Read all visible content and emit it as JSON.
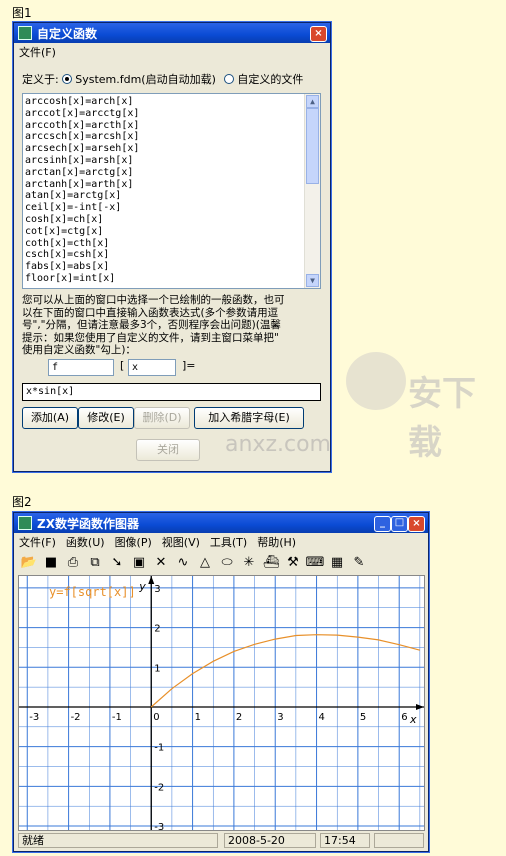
{
  "fig1": {
    "caption": "图1",
    "title": "自定义函数",
    "menu": [
      "文件(F)"
    ],
    "define_label": "定义于:",
    "radio_system": "System.fdm(启动自动加载)",
    "radio_custom": "自定义的文件",
    "functions": [
      "arccosh[x]=arch[x]",
      "arccot[x]=arcctg[x]",
      "arccoth[x]=arcth[x]",
      "arccsch[x]=arcsh[x]",
      "arcsech[x]=arseh[x]",
      "arcsinh[x]=arsh[x]",
      "arctan[x]=arctg[x]",
      "arctanh[x]=arth[x]",
      "atan[x]=arctg[x]",
      "ceil[x]=-int[-x]",
      "cosh[x]=ch[x]",
      "cot[x]=ctg[x]",
      "coth[x]=cth[x]",
      "csch[x]=csh[x]",
      "fabs[x]=abs[x]",
      "floor[x]=int[x]"
    ],
    "help_lines": [
      "您可以从上面的窗口中选择一个已绘制的一般函数，也可",
      "以在下面的窗口中直接输入函数表达式(多个参数请用逗",
      "号\",\"分隔，但请注意最多3个，否则程序会出问题)(温馨",
      "提示：如果您使用了自定义的文件，请到主窗口菜单把\"",
      "使用自定义函数\"勾上)："
    ],
    "func_name": "f",
    "param": "x",
    "bracket_open": "[",
    "bracket_close": "]=",
    "expression": "x*sin[x]",
    "btn_add": "添加(A)",
    "btn_modify": "修改(E)",
    "btn_delete": "删除(D)",
    "btn_add_greek": "加入希腊字母(E)",
    "btn_close": "关闭",
    "close_icon": "×"
  },
  "watermark": {
    "text": "安下载",
    "url": "anxz.com"
  },
  "fig2": {
    "caption": "图2",
    "title": "ZX数学函数作图器",
    "menu": [
      "文件(F)",
      "函数(U)",
      "图像(P)",
      "视图(V)",
      "工具(T)",
      "帮助(H)"
    ],
    "toolbar_icons": [
      "open-icon",
      "save-icon",
      "print-icon",
      "copy-icon",
      "arrow-icon",
      "frame-icon",
      "cross-icon",
      "curve-icon",
      "triangle-icon",
      "ellipse-icon",
      "asterisk-icon",
      "ship-icon",
      "hammer-icon",
      "keyboard-icon",
      "calculator-icon",
      "tool-icon"
    ],
    "status_text": "就绪",
    "status_date": "2008-5-20",
    "status_time": "17:54",
    "min_icon": "_",
    "max_icon": "□",
    "close_icon": "×"
  },
  "chart_data": {
    "type": "line",
    "series": [
      {
        "name": "y=f[sqrt[x]]",
        "function": "y=sqrt(x)*sin(sqrt(x))",
        "x": [
          0,
          0.5,
          1,
          1.5,
          2,
          2.5,
          3,
          3.5,
          4,
          4.5,
          5,
          5.5,
          6,
          6.5
        ],
        "y": [
          0,
          0.46,
          0.84,
          1.15,
          1.4,
          1.58,
          1.71,
          1.8,
          1.82,
          1.81,
          1.76,
          1.69,
          1.57,
          1.43
        ]
      }
    ],
    "xlabel": "x",
    "ylabel": "y",
    "xlim": [
      -3.2,
      6.6
    ],
    "ylim": [
      -3.1,
      3.3
    ],
    "xticks": [
      -3,
      -2,
      -1,
      0,
      1,
      2,
      3,
      4,
      5,
      6
    ],
    "yticks": [
      3,
      2,
      1,
      -1,
      -2,
      -3
    ],
    "grid": true,
    "colors": {
      "curve": "#e8902a",
      "grid": "#3a78d8",
      "axis": "#000000",
      "label": "#e8902a"
    }
  }
}
